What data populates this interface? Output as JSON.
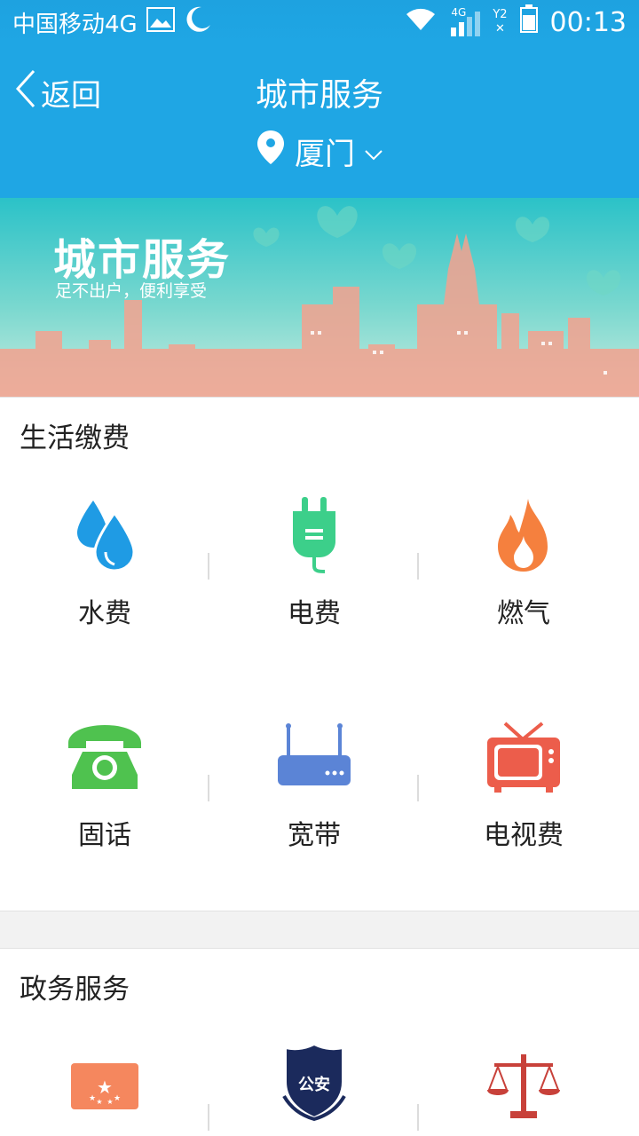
{
  "status": {
    "carrier": "中国移动4G",
    "network_small": "4G",
    "sim": "Y2",
    "time": "00:13"
  },
  "nav": {
    "back_label": "返回",
    "title": "城市服务",
    "city": "厦门"
  },
  "banner": {
    "title": "城市服务",
    "subtitle": "足不出户，便利享受"
  },
  "life_section": {
    "title": "生活缴费",
    "items": [
      {
        "label": "水费",
        "icon": "water-drop-icon"
      },
      {
        "label": "电费",
        "icon": "plug-icon"
      },
      {
        "label": "燃气",
        "icon": "flame-icon"
      },
      {
        "label": "固话",
        "icon": "telephone-icon"
      },
      {
        "label": "宽带",
        "icon": "router-icon"
      },
      {
        "label": "电视费",
        "icon": "tv-icon"
      }
    ]
  },
  "gov_section": {
    "title": "政务服务",
    "items": [
      {
        "icon": "flag-icon"
      },
      {
        "icon": "police-badge-icon",
        "badge_text": "公安"
      },
      {
        "icon": "scales-icon"
      }
    ]
  },
  "colors": {
    "primary": "#1fa6e4",
    "water": "#1f9be4",
    "electric": "#3ccf8a",
    "gas": "#f5803e",
    "phone": "#4fc24f",
    "broadband": "#5b84d6",
    "tv": "#ec5d4b"
  }
}
